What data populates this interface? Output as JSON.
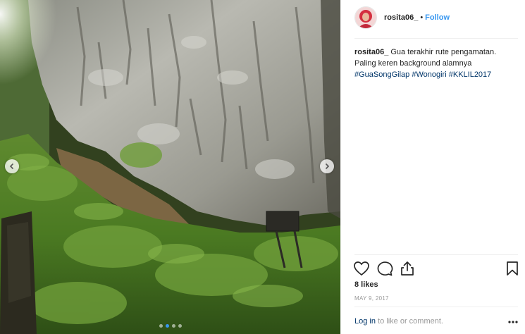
{
  "post": {
    "username": "rosita06_",
    "separator": "•",
    "follow_label": "Follow",
    "caption": {
      "text_line1": "Gua terakhir rute pengamatan.",
      "text_line2": "Paling keren background alamnya",
      "hashtags": [
        "#GuaSongGilap",
        "#Wonogiri",
        "#KKLIL2017"
      ]
    },
    "likes_label": "8 likes",
    "date_label": "MAY 9, 2017",
    "comment": {
      "login_label": "Log in",
      "rest_label": "to like or comment."
    }
  },
  "photo": {
    "description": "",
    "carousel_dots": 4,
    "active_dot": 1
  },
  "icons": {
    "like": "heart-icon",
    "comment": "comment-bubble-icon",
    "share": "share-upload-icon",
    "save": "bookmark-icon",
    "more": "more-options-icon",
    "prev": "chevron-left-icon",
    "next": "chevron-right-icon"
  },
  "colors": {
    "link_blue": "#3897f0",
    "hashtag_blue": "#003569",
    "text_dark": "#262626",
    "text_gray": "#999999",
    "border": "#efefef"
  }
}
